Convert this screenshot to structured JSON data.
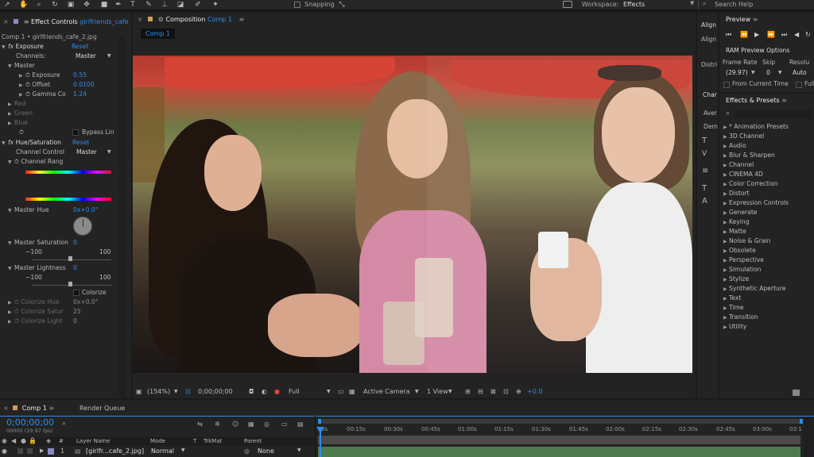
{
  "topbar": {
    "snapping": "Snapping",
    "workspace_label": "Workspace:",
    "workspace_value": "Effects",
    "search_help": "Search Help"
  },
  "effect_controls": {
    "tab_label": "Effect Controls",
    "tab_layer": "girlfriends_cafe",
    "layer_path": "Comp 1 • girlfriends_cafe_2.jpg",
    "exposure": {
      "name": "Exposure",
      "reset": "Reset",
      "channels_label": "Channels:",
      "channels_value": "Master",
      "master_label": "Master",
      "props": [
        {
          "label": "Exposure",
          "value": "0.55"
        },
        {
          "label": "Offset",
          "value": "0.0100"
        },
        {
          "label": "Gamma Co",
          "value": "1.24"
        }
      ],
      "channels": [
        "Red",
        "Green",
        "Blue"
      ],
      "bypass": "Bypass Lin"
    },
    "hue": {
      "name": "Hue/Saturation",
      "reset": "Reset",
      "channel_control_label": "Channel Control",
      "channel_control_value": "Master",
      "channel_range": "Channel Rang",
      "master_hue_label": "Master Hue",
      "master_hue_value": "0x+0.0°",
      "master_sat_label": "Master Saturation",
      "master_sat_value": "0",
      "sat_min": "−100",
      "sat_max": "100",
      "master_light_label": "Master Lightness",
      "master_light_value": "0",
      "light_min": "−100",
      "light_max": "100",
      "colorize": "Colorize",
      "colorize_props": [
        {
          "label": "Colorize Hue",
          "value": "0x+0.0°"
        },
        {
          "label": "Colorize Satur",
          "value": "25"
        },
        {
          "label": "Colorize Light",
          "value": "0"
        }
      ]
    }
  },
  "composition": {
    "tab_label": "Composition",
    "tab_comp": "Comp 1",
    "subtab": "Comp 1",
    "footer": {
      "zoom": "(154%)",
      "timecode": "0;00;00;00",
      "resolution": "Full",
      "camera": "Active Camera",
      "view": "1 View",
      "exposure": "+0.0"
    }
  },
  "side_strip": {
    "items": [
      "Align",
      "Align",
      "Distri",
      "Char",
      "Aver",
      "Dem"
    ]
  },
  "preview": {
    "tab_label": "Preview",
    "ram_options": "RAM Preview Options",
    "frame_rate_label": "Frame Rate",
    "frame_rate_value": "(29.97)",
    "skip_label": "Skip",
    "skip_value": "0",
    "resolution_label": "Resolu",
    "resolution_value": "Auto",
    "from_current": "From Current Time",
    "full": "Full"
  },
  "effects_presets": {
    "tab_label": "Effects & Presets",
    "items": [
      "* Animation Presets",
      "3D Channel",
      "Audio",
      "Blur & Sharpen",
      "Channel",
      "CINEMA 4D",
      "Color Correction",
      "Distort",
      "Expression Controls",
      "Generate",
      "Keying",
      "Matte",
      "Noise & Grain",
      "Obsolete",
      "Perspective",
      "Simulation",
      "Stylize",
      "Synthetic Aperture",
      "Text",
      "Time",
      "Transition",
      "Utility"
    ]
  },
  "timeline": {
    "tab_comp": "Comp 1",
    "tab_render": "Render Queue",
    "timecode": "0;00;00;00",
    "fps": "00000 (29.97 fps)",
    "columns": {
      "layer_name": "Layer Name",
      "mode": "Mode",
      "t": "T",
      "trkmat": "TrkMat",
      "parent": "Parent"
    },
    "layer": {
      "index": "1",
      "name": "[girlfr...cafe_2.jpg]",
      "mode": "Normal",
      "parent": "None"
    },
    "ruler": [
      "0s",
      "00:15s",
      "00:30s",
      "00:45s",
      "01:00s",
      "01:15s",
      "01:30s",
      "01:45s",
      "02:00s",
      "02:15s",
      "02:30s",
      "02:45s",
      "03:00s",
      "03:1"
    ]
  },
  "colors": {
    "accent": "#2d8ceb",
    "panel": "#232323",
    "background": "#1b1b1b",
    "layer_bar": "#5b8a5b"
  }
}
